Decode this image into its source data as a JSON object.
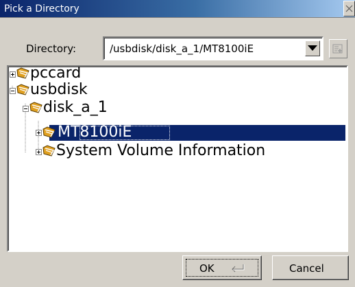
{
  "window": {
    "title": "Pick a Directory"
  },
  "directory": {
    "label": "Directory:",
    "value": "/usbdisk/disk_a_1/MT8100iE"
  },
  "tree": {
    "nodes": [
      {
        "label": "pccard",
        "expander": "plus",
        "depth": 0
      },
      {
        "label": "usbdisk",
        "expander": "minus",
        "depth": 0
      },
      {
        "label": "disk_a_1",
        "expander": "minus",
        "depth": 1
      },
      {
        "label": "MT8100iE",
        "expander": "plus",
        "depth": 2,
        "selected": true
      },
      {
        "label": "System Volume Information",
        "expander": "plus",
        "depth": 2
      }
    ]
  },
  "buttons": {
    "ok_label": "OK",
    "cancel_label": "Cancel"
  },
  "icons": {
    "close": "close-icon",
    "dropdown": "chevron-down-icon",
    "new_folder": "new-folder-icon",
    "folder": "folder-icon",
    "enter": "enter-key-icon"
  },
  "colors": {
    "selection": "#0a246a",
    "title_bar_start": "#0a246a",
    "title_bar_end": "#a6caf0"
  }
}
